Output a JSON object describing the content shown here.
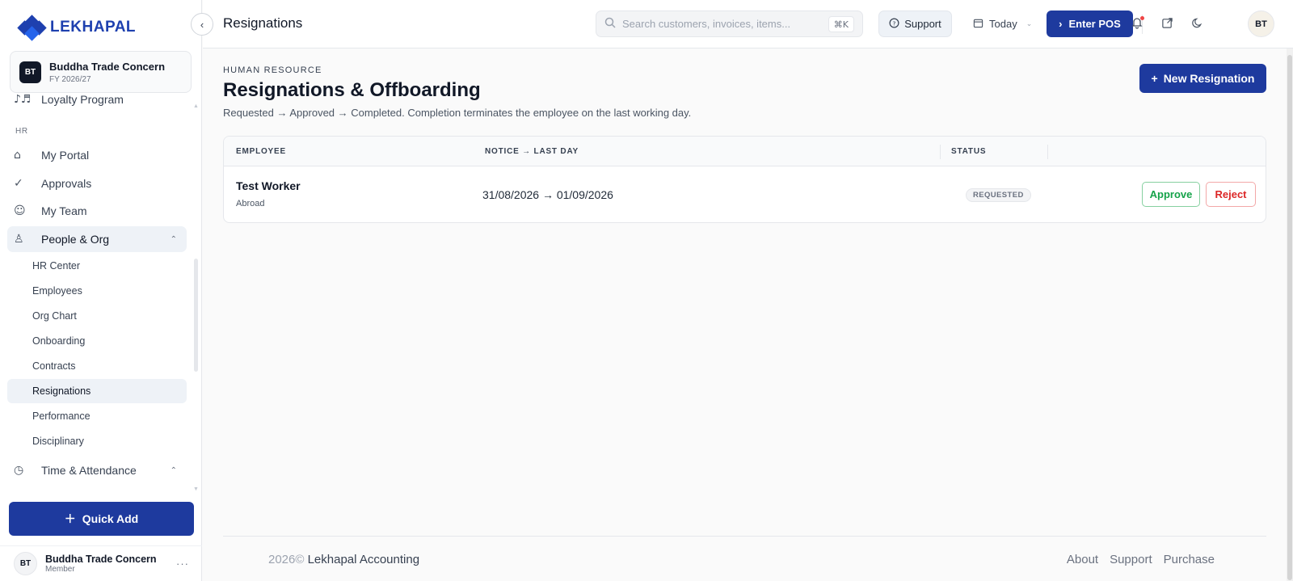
{
  "brand": {
    "name": "LEKHAPAL",
    "color": "#1e40af"
  },
  "company": {
    "initials": "BT",
    "name": "Buddha Trade Concern",
    "fy": "FY 2026/27"
  },
  "sidebar": {
    "partial_item": {
      "icon": "loyalty-icon",
      "label": "Loyalty Program"
    },
    "section_hr": "HR",
    "items": [
      {
        "icon": "portal-icon",
        "label": "My Portal"
      },
      {
        "icon": "approvals-icon",
        "label": "Approvals"
      },
      {
        "icon": "team-icon",
        "label": "My Team"
      },
      {
        "icon": "people-org-icon",
        "label": "People & Org"
      }
    ],
    "sub_items": [
      "HR Center",
      "Employees",
      "Org Chart",
      "Onboarding",
      "Contracts",
      "Resignations",
      "Performance",
      "Disciplinary"
    ],
    "active_sub": "Resignations",
    "time_attendance": {
      "icon": "clock-icon",
      "label": "Time & Attendance"
    }
  },
  "quick_add": {
    "label": "Quick Add"
  },
  "user": {
    "initials": "BT",
    "name": "Buddha Trade Concern",
    "role": "Member"
  },
  "topbar": {
    "title": "Resignations",
    "search_placeholder": "Search customers, invoices, items...",
    "shortcut": "⌘K",
    "support_label": "Support",
    "date_filter": "Today",
    "enter_pos_label": "Enter POS",
    "avatar_initials": "BT"
  },
  "page": {
    "eyebrow": "HUMAN RESOURCE",
    "title": "Resignations & Offboarding",
    "subtitle": "Requested → Approved → Completed. Completion terminates the employee on the last working day.",
    "new_button": "New Resignation"
  },
  "table": {
    "headers": {
      "employee": "EMPLOYEE",
      "notice": "NOTICE → LAST DAY",
      "status": "STATUS"
    },
    "rows": [
      {
        "employee": "Test Worker",
        "note": "Abroad",
        "dates": "31/08/2026 → 01/09/2026",
        "status": "REQUESTED",
        "approve": "Approve",
        "reject": "Reject"
      }
    ]
  },
  "footer": {
    "year": "2026©",
    "brand": "Lekhapal Accounting",
    "links": [
      "About",
      "Support",
      "Purchase"
    ]
  },
  "colors": {
    "primary": "#1e3a9e",
    "approve": "#16a34a",
    "reject": "#dc2626"
  }
}
